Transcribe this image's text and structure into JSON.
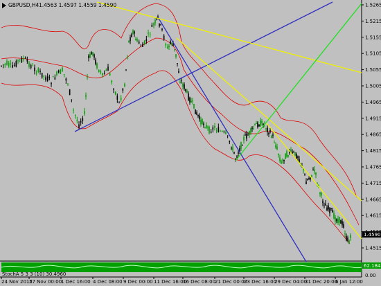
{
  "window": {
    "symbol": "GBPUSD,H4",
    "ohlc": "1.4563 1.4597 1.4559 1.4590"
  },
  "colors": {
    "background": "#c0c0c0",
    "candle_bull": "#00a000",
    "candle_bear": "#000000",
    "bollinger": "#e00000",
    "trend_blue": "#3030c0",
    "trend_yellow": "#f0f000",
    "trend_green": "#20e020",
    "osc_bg": "#00c000",
    "price_badge_bg": "#000000"
  },
  "price_axis": {
    "labels": [
      "1.5265",
      "1.5215",
      "1.5155",
      "1.5105",
      "1.5055",
      "1.5005",
      "1.4965",
      "1.4915",
      "1.4865",
      "1.4815",
      "1.4765",
      "1.4715",
      "1.4665",
      "1.4615",
      "1.4565",
      "1.4515"
    ],
    "current_price": "1.4590"
  },
  "time_axis": {
    "labels": [
      "24 Nov 2015",
      "27 Nov 00:00",
      "1 Dec 16:00",
      "4 Dec 08:00",
      "9 Dec 00:00",
      "11 Dec 16:00",
      "16 Dec 08:00",
      "21 Dec 00:00",
      "23 Dec 16:00",
      "29 Dec 04:00",
      "31 Dec 20:00",
      "6 Jan 12:00"
    ]
  },
  "oscillator": {
    "label": "StochA 5 3 3 (10) 30.4960",
    "top_value": "62.1848",
    "bottom_value": "0.00"
  },
  "chart_data": {
    "type": "candlestick",
    "symbol": "GBPUSD",
    "timeframe": "H4",
    "ylim": [
      1.4515,
      1.5265
    ],
    "x": [
      "24 Nov 2015",
      "27 Nov 00:00",
      "1 Dec 16:00",
      "4 Dec 08:00",
      "9 Dec 00:00",
      "11 Dec 16:00",
      "16 Dec 08:00",
      "21 Dec 00:00",
      "23 Dec 16:00",
      "29 Dec 04:00",
      "31 Dec 20:00",
      "6 Jan 12:00"
    ],
    "series": [
      {
        "values": [
          1.5065,
          1.505,
          1.489,
          1.5105,
          1.5215,
          1.503,
          1.49,
          1.4835,
          1.494,
          1.48,
          1.472,
          1.459
        ]
      }
    ],
    "last_close": 1.459
  }
}
